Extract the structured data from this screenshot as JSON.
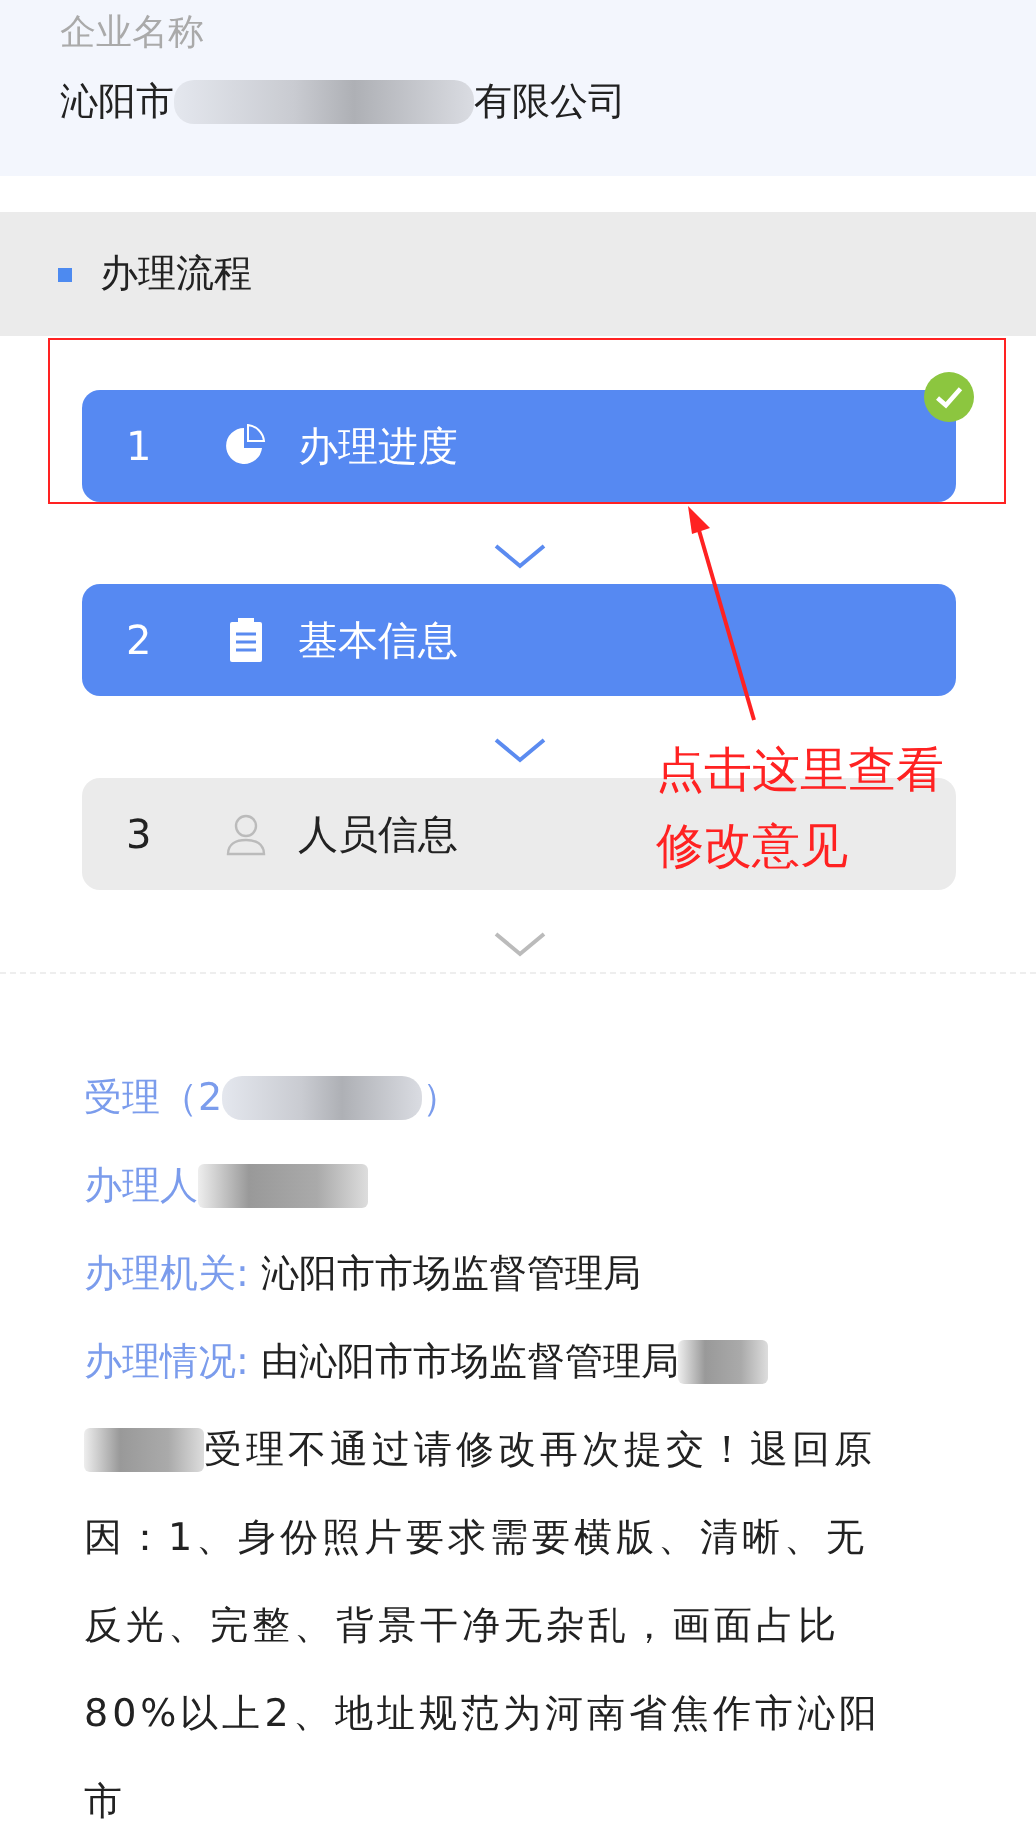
{
  "company": {
    "label": "企业名称",
    "name_start": "沁阳市",
    "name_end": "有限公司"
  },
  "section": {
    "title": "办理流程"
  },
  "steps": [
    {
      "number": "1",
      "label": "办理进度",
      "active": true,
      "done": true
    },
    {
      "number": "2",
      "label": "基本信息",
      "active": true,
      "done": false
    },
    {
      "number": "3",
      "label": "人员信息",
      "active": false,
      "done": false
    }
  ],
  "annotation": {
    "lines": [
      "点击这里查看",
      "修改意见"
    ]
  },
  "details": {
    "title_start": "受理（2",
    "title_end": "）",
    "handler_label": "办理人",
    "agency_label": "办理机关:",
    "agency": "沁阳市市场监督管理局",
    "status_label": "办理情况:",
    "status_start": "由沁阳市市场监督管理局",
    "status_mid": "受理不通过请修改再次提交！退回原",
    "status_end": "因：1、身份照片要求需要横版、清晰、无反光、完整、背景干净无杂乱，画面占比80%以上2、地址规范为河南省焦作市沁阳市"
  }
}
